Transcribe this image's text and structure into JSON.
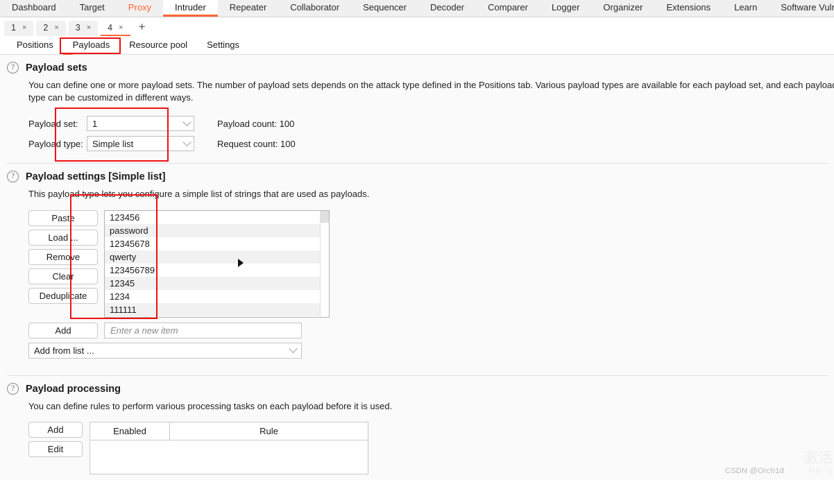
{
  "main_tabs": [
    {
      "label": "Dashboard",
      "state": "normal"
    },
    {
      "label": "Target",
      "state": "normal"
    },
    {
      "label": "Proxy",
      "state": "accent"
    },
    {
      "label": "Intruder",
      "state": "active"
    },
    {
      "label": "Repeater",
      "state": "normal"
    },
    {
      "label": "Collaborator",
      "state": "normal"
    },
    {
      "label": "Sequencer",
      "state": "normal"
    },
    {
      "label": "Decoder",
      "state": "normal"
    },
    {
      "label": "Comparer",
      "state": "normal"
    },
    {
      "label": "Logger",
      "state": "normal"
    },
    {
      "label": "Organizer",
      "state": "normal"
    },
    {
      "label": "Extensions",
      "state": "normal"
    },
    {
      "label": "Learn",
      "state": "normal"
    },
    {
      "label": "Software Vulnerabilit",
      "state": "normal"
    }
  ],
  "attack_tabs": [
    {
      "label": "1",
      "close": "×",
      "active": false
    },
    {
      "label": "2",
      "close": "×",
      "active": false
    },
    {
      "label": "3",
      "close": "×",
      "active": false
    },
    {
      "label": "4",
      "close": "×",
      "active": true
    }
  ],
  "attack_add_label": "+",
  "sub_tabs": [
    {
      "label": "Positions",
      "active": false
    },
    {
      "label": "Payloads",
      "active": true
    },
    {
      "label": "Resource pool",
      "active": false
    },
    {
      "label": "Settings",
      "active": false
    }
  ],
  "payload_sets": {
    "help": "?",
    "title": "Payload sets",
    "description": "You can define one or more payload sets. The number of payload sets depends on the attack type defined in the Positions tab. Various payload types are available for each payload set, and each payload type can be customized in different ways.",
    "payload_set_label": "Payload set:",
    "payload_set_value": "1",
    "payload_type_label": "Payload type:",
    "payload_type_value": "Simple list",
    "payload_count": "Payload count: 100",
    "request_count": "Request count: 100"
  },
  "payload_settings": {
    "help": "?",
    "title": "Payload settings [Simple list]",
    "description": "This payload type lets you configure a simple list of strings that are used as payloads.",
    "buttons": [
      {
        "label": "Paste"
      },
      {
        "label": "Load ..."
      },
      {
        "label": "Remove"
      },
      {
        "label": "Clear"
      },
      {
        "label": "Deduplicate"
      }
    ],
    "items": [
      "123456",
      "password",
      "12345678",
      "qwerty",
      "123456789",
      "12345",
      "1234",
      "111111"
    ],
    "add_button": "Add",
    "new_item_placeholder": "Enter a new item",
    "add_from_list": "Add from list ..."
  },
  "payload_processing": {
    "help": "?",
    "title": "Payload processing",
    "description": "You can define rules to perform various processing tasks on each payload before it is used.",
    "buttons": [
      {
        "label": "Add"
      },
      {
        "label": "Edit"
      }
    ],
    "columns": [
      "Enabled",
      "Rule"
    ]
  },
  "watermark": {
    "csdn": "CSDN @Orch1d",
    "activate_line1": "激活",
    "activate_line2": "转到“设"
  },
  "colors": {
    "accent": "#ff6633",
    "annotation": "#ee1111",
    "background": "#fafafa"
  }
}
